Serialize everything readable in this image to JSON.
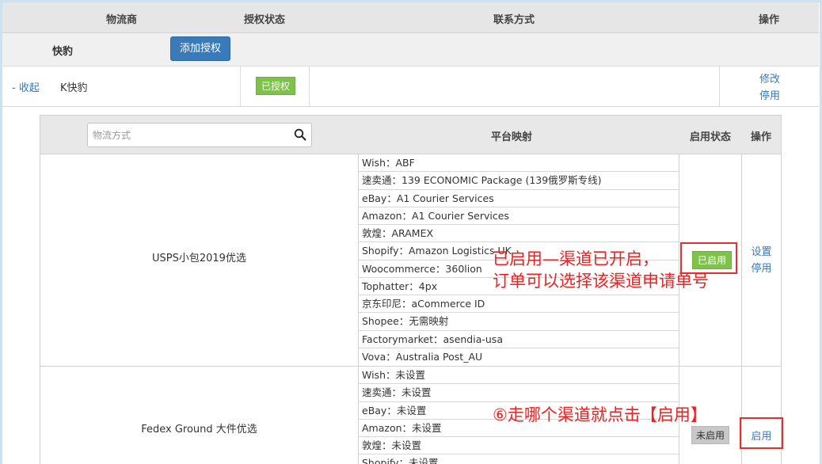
{
  "header": {
    "carrier": "物流商",
    "auth_status": "授权状态",
    "contact": "联系方式",
    "operation": "操作"
  },
  "provider": {
    "name": "快豹",
    "add_auth_label": "添加授权"
  },
  "account": {
    "collapse_label": "- 收起",
    "name": "K快豹",
    "status": "已授权",
    "edit_label": "修改",
    "disable_label": "停用"
  },
  "inner_header": {
    "search_placeholder": "物流方式",
    "platform_mapping": "平台映射",
    "enable_status": "启用状态",
    "operation": "操作"
  },
  "channels": [
    {
      "name": "USPS小包2019优选",
      "mappings": [
        "Wish：ABF",
        "速卖通：139 ECONOMIC Package (139俄罗斯专线)",
        "eBay：A1 Courier Services",
        "Amazon：A1 Courier Services",
        "敦煌：ARAMEX",
        "Shopify：Amazon Logistics UK",
        "Woocommerce：360lion",
        "Tophatter：4px",
        "京东印尼：aCommerce ID",
        "Shopee：无需映射",
        "Factorymarket：asendia-usa",
        "Vova：Australia Post_AU"
      ],
      "status": "已启用",
      "op1": "设置",
      "op2": "停用"
    },
    {
      "name": "Fedex Ground 大件优选",
      "mappings": [
        "Wish：未设置",
        "速卖通：未设置",
        "eBay：未设置",
        "Amazon：未设置",
        "敦煌：未设置",
        "Shopify：未设置"
      ],
      "status": "未启用",
      "op1": "启用"
    }
  ],
  "annotations": {
    "enabled_line1": "已启用—渠道已开启，",
    "enabled_line2": "订单可以选择该渠道申请单号",
    "step6": "⑥走哪个渠道就点击【启用】"
  },
  "colors": {
    "link": "#3a7ab8",
    "enabled_badge": "#7ec24a",
    "disabled_badge": "#c8c8c8",
    "annotation": "#ee2020",
    "button": "#3a7ab8"
  }
}
